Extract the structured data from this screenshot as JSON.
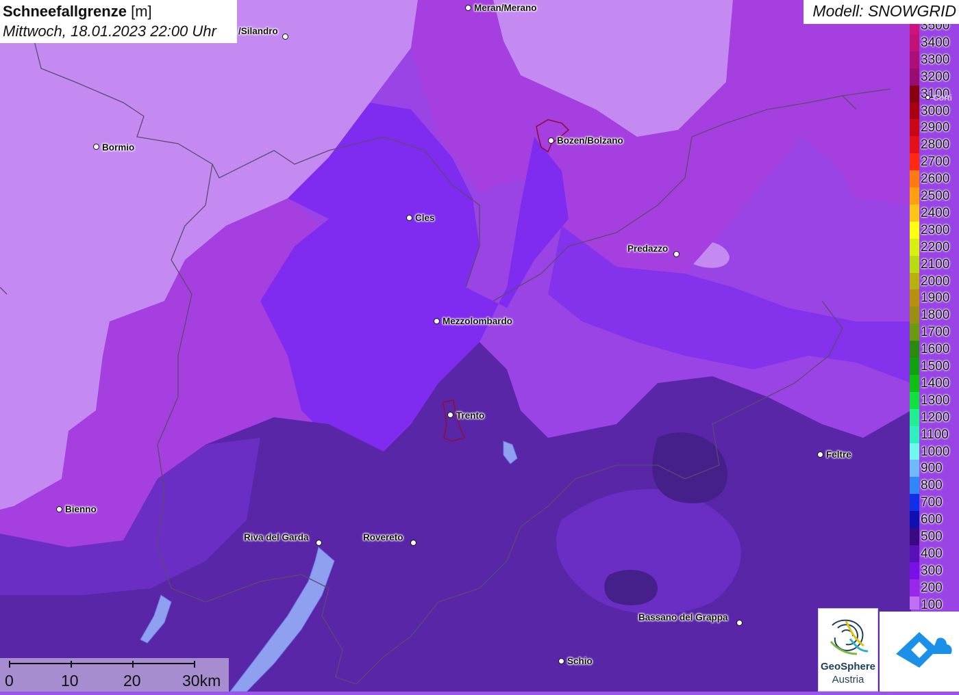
{
  "title": {
    "parameter": "Schneefallgrenze",
    "unit": "[m]",
    "datetime": "Mittwoch, 18.01.2023 22:00 Uhr"
  },
  "model_label": "Modell: SNOWGRID",
  "legend": {
    "items": [
      {
        "label": "3500",
        "color": "#d0137a"
      },
      {
        "label": "3400",
        "color": "#c21278"
      },
      {
        "label": "3300",
        "color": "#ae0f76"
      },
      {
        "label": "3200",
        "color": "#9a0c72"
      },
      {
        "label": "3100",
        "color": "#880010"
      },
      {
        "label": "3000",
        "color": "#a80010"
      },
      {
        "label": "2900",
        "color": "#c80816"
      },
      {
        "label": "2800",
        "color": "#e4101a"
      },
      {
        "label": "2700",
        "color": "#ff2a10"
      },
      {
        "label": "2600",
        "color": "#ff7a10"
      },
      {
        "label": "2500",
        "color": "#ffa010"
      },
      {
        "label": "2400",
        "color": "#ffc418"
      },
      {
        "label": "2300",
        "color": "#ffff10"
      },
      {
        "label": "2200",
        "color": "#d8f010"
      },
      {
        "label": "2100",
        "color": "#b8dc10"
      },
      {
        "label": "2000",
        "color": "#b8b010"
      },
      {
        "label": "1900",
        "color": "#b89010"
      },
      {
        "label": "1800",
        "color": "#989010"
      },
      {
        "label": "1700",
        "color": "#6a9a10"
      },
      {
        "label": "1600",
        "color": "#2a8a10"
      },
      {
        "label": "1500",
        "color": "#10a010"
      },
      {
        "label": "1400",
        "color": "#10c010"
      },
      {
        "label": "1300",
        "color": "#10e040"
      },
      {
        "label": "1200",
        "color": "#20f090"
      },
      {
        "label": "1100",
        "color": "#30f0c0"
      },
      {
        "label": "1000",
        "color": "#70f8f0"
      },
      {
        "label": "900",
        "color": "#70b8f8"
      },
      {
        "label": "800",
        "color": "#3088f8"
      },
      {
        "label": "700",
        "color": "#1030e8"
      },
      {
        "label": "600",
        "color": "#1010b0"
      },
      {
        "label": "500",
        "color": "#3a0a80"
      },
      {
        "label": "400",
        "color": "#5a10b8"
      },
      {
        "label": "300",
        "color": "#7a10e8"
      },
      {
        "label": "200",
        "color": "#9a28e8"
      },
      {
        "label": "100",
        "color": "#c070f0"
      }
    ]
  },
  "cities": [
    {
      "name": "Meran/Merano"
    },
    {
      "name": "/Silandro"
    },
    {
      "name": "Bormio"
    },
    {
      "name": "Bozen/Bolzano"
    },
    {
      "name": "Cles"
    },
    {
      "name": "Predazzo"
    },
    {
      "name": "Mezzolombardo"
    },
    {
      "name": "Trento"
    },
    {
      "name": "Feltre"
    },
    {
      "name": "Bienno"
    },
    {
      "name": "Riva del Garda"
    },
    {
      "name": "Rovereto"
    },
    {
      "name": "Bassano del Grappa"
    },
    {
      "name": "Schio"
    },
    {
      "name": "Corti"
    }
  ],
  "scale_bar": {
    "labels": [
      "0",
      "10",
      "20",
      "30km"
    ]
  },
  "logos": {
    "geosphere_line1": "GeoSphere",
    "geosphere_line2": "Austria"
  }
}
